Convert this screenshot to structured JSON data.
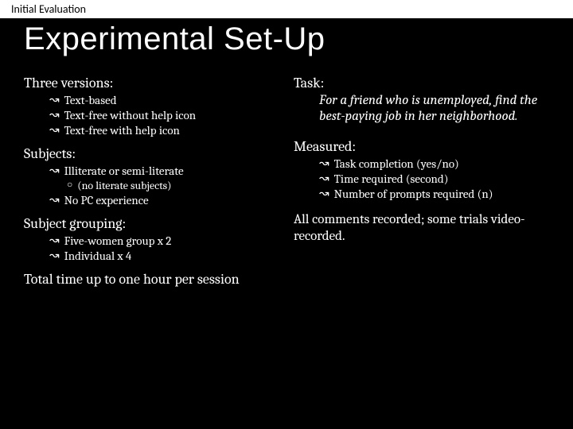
{
  "header": "Initial Evaluation",
  "title": "Experimental Set-Up",
  "left": {
    "versions_heading": "Three versions:",
    "versions": [
      "Text-based",
      "Text-free without help icon",
      "Text-free with help icon"
    ],
    "subjects_heading": "Subjects:",
    "subjects_item1": "Illiterate or semi-literate",
    "subjects_sub": "(no literate subjects)",
    "subjects_item2": "No PC experience",
    "grouping_heading": "Subject grouping:",
    "grouping": [
      "Five-women group x 2",
      "Individual x 4"
    ],
    "total_time": "Total time up to one hour per session"
  },
  "right": {
    "task_heading": "Task:",
    "task_body": "For a friend who is unemployed, find the best-paying job in her neighborhood.",
    "measured_heading": "Measured:",
    "measured": [
      "Task completion (yes/no)",
      "Time required (second)",
      "Number of prompts required (n)"
    ],
    "comments": "All comments recorded; some trials video-recorded."
  },
  "bullets": {
    "arrow": "↝",
    "circle": "○"
  }
}
